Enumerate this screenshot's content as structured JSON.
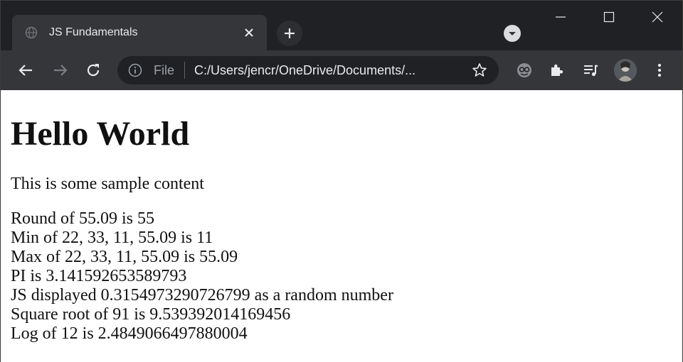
{
  "browser": {
    "tab": {
      "title": "JS Fundamentals"
    },
    "omnibox": {
      "scheme_label": "File",
      "url": "C:/Users/jencr/OneDrive/Documents/..."
    },
    "icons": {
      "favicon": "globe-icon",
      "tab_close": "close-icon",
      "new_tab": "plus-icon",
      "tab_search": "chevron-down-icon",
      "minimize": "minimize-icon",
      "maximize": "maximize-icon",
      "close": "close-icon",
      "back": "arrow-left-icon",
      "forward": "arrow-right-icon",
      "reload": "reload-icon",
      "info": "info-icon",
      "bookmark": "star-icon",
      "extension": "extension-icon",
      "extensions_menu": "puzzle-icon",
      "media": "media-queue-icon",
      "profile": "avatar",
      "menu": "kebab-menu-icon"
    },
    "colors": {
      "frame": "#202124",
      "toolbar": "#35363a",
      "text": "#e8eaed",
      "muted": "#9aa0a6",
      "page_background": "#ffffff"
    }
  },
  "page": {
    "heading": "Hello World",
    "intro": "This is some sample content",
    "results": [
      "Round of 55.09 is 55",
      "Min of 22, 33, 11, 55.09 is 11",
      "Max of 22, 33, 11, 55.09 is 55.09",
      "PI is 3.141592653589793",
      "JS displayed 0.3154973290726799 as a random number",
      "Square root of 91 is 9.539392014169456",
      "Log of 12 is 2.4849066497880004"
    ]
  }
}
